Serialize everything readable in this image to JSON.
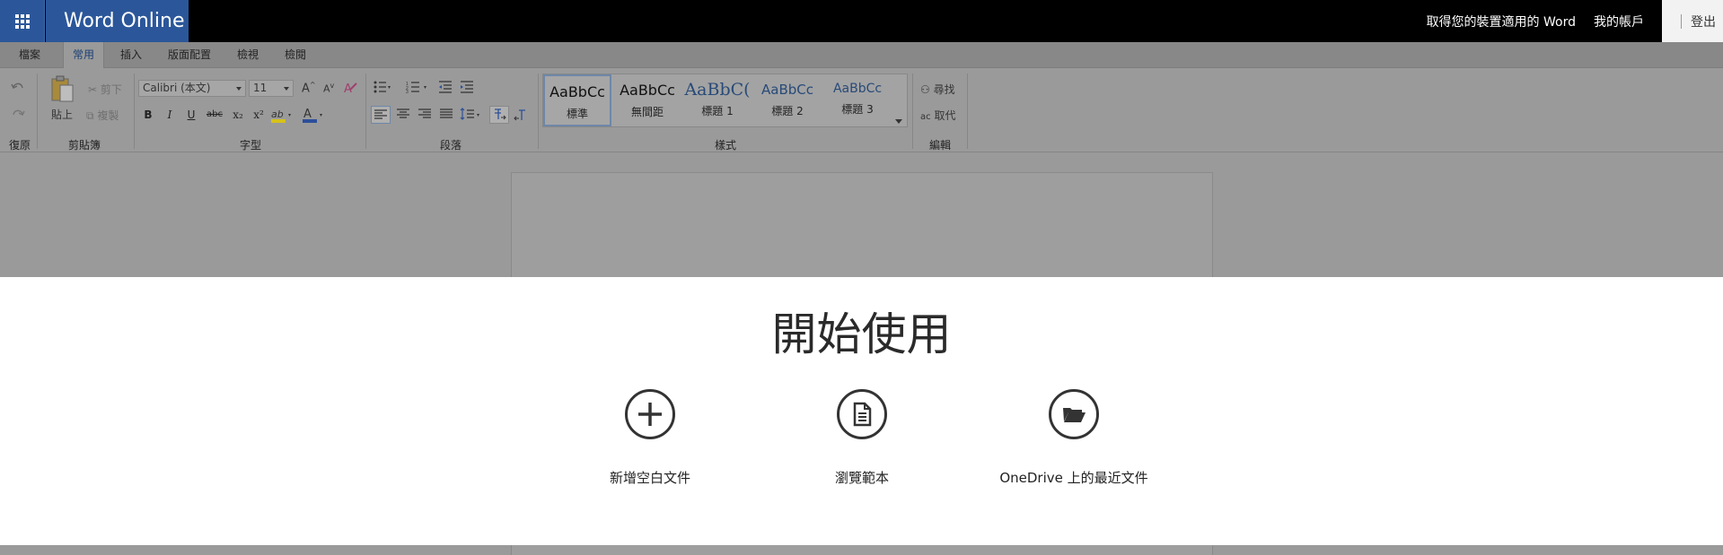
{
  "header": {
    "app_title": "Word Online",
    "get_word_link": "取得您的裝置適用的 Word",
    "my_account_link": "我的帳戶",
    "sign_out_link": "登出"
  },
  "tabs": [
    "檔案",
    "常用",
    "插入",
    "版面配置",
    "檢視",
    "檢閱"
  ],
  "active_tab": "常用",
  "ribbon": {
    "groups": {
      "undo": "復原",
      "clipboard": "剪貼簿",
      "font": "字型",
      "paragraph": "段落",
      "styles": "樣式",
      "editing": "編輯"
    },
    "clipboard": {
      "paste": "貼上",
      "cut": "剪下",
      "copy": "複製"
    },
    "font": {
      "name": "Calibri (本文)",
      "size": "11",
      "bold": "B",
      "italic": "I",
      "underline": "U",
      "strike": "abc",
      "subscript": "x₂",
      "superscript": "x²"
    },
    "styles": [
      {
        "sample": "AaBbCc",
        "name": "標準"
      },
      {
        "sample": "AaBbCc",
        "name": "無間距"
      },
      {
        "sample": "AaBbC(",
        "name": "標題 1"
      },
      {
        "sample": "AaBbCc",
        "name": "標題 2"
      },
      {
        "sample": "AaBbCc",
        "name": "標題 3"
      }
    ],
    "editing": {
      "find": "尋找",
      "replace": "取代"
    }
  },
  "start": {
    "title": "開始使用",
    "actions": [
      {
        "label": "新增空白文件",
        "icon": "plus-circle-icon"
      },
      {
        "label": "瀏覽範本",
        "icon": "document-circle-icon"
      },
      {
        "label": "OneDrive 上的最近文件",
        "icon": "folder-open-circle-icon"
      }
    ]
  },
  "colors": {
    "brand": "#2b579a",
    "topbar": "#000000",
    "overlay": "#9a9a9a",
    "panel": "#ffffff"
  }
}
